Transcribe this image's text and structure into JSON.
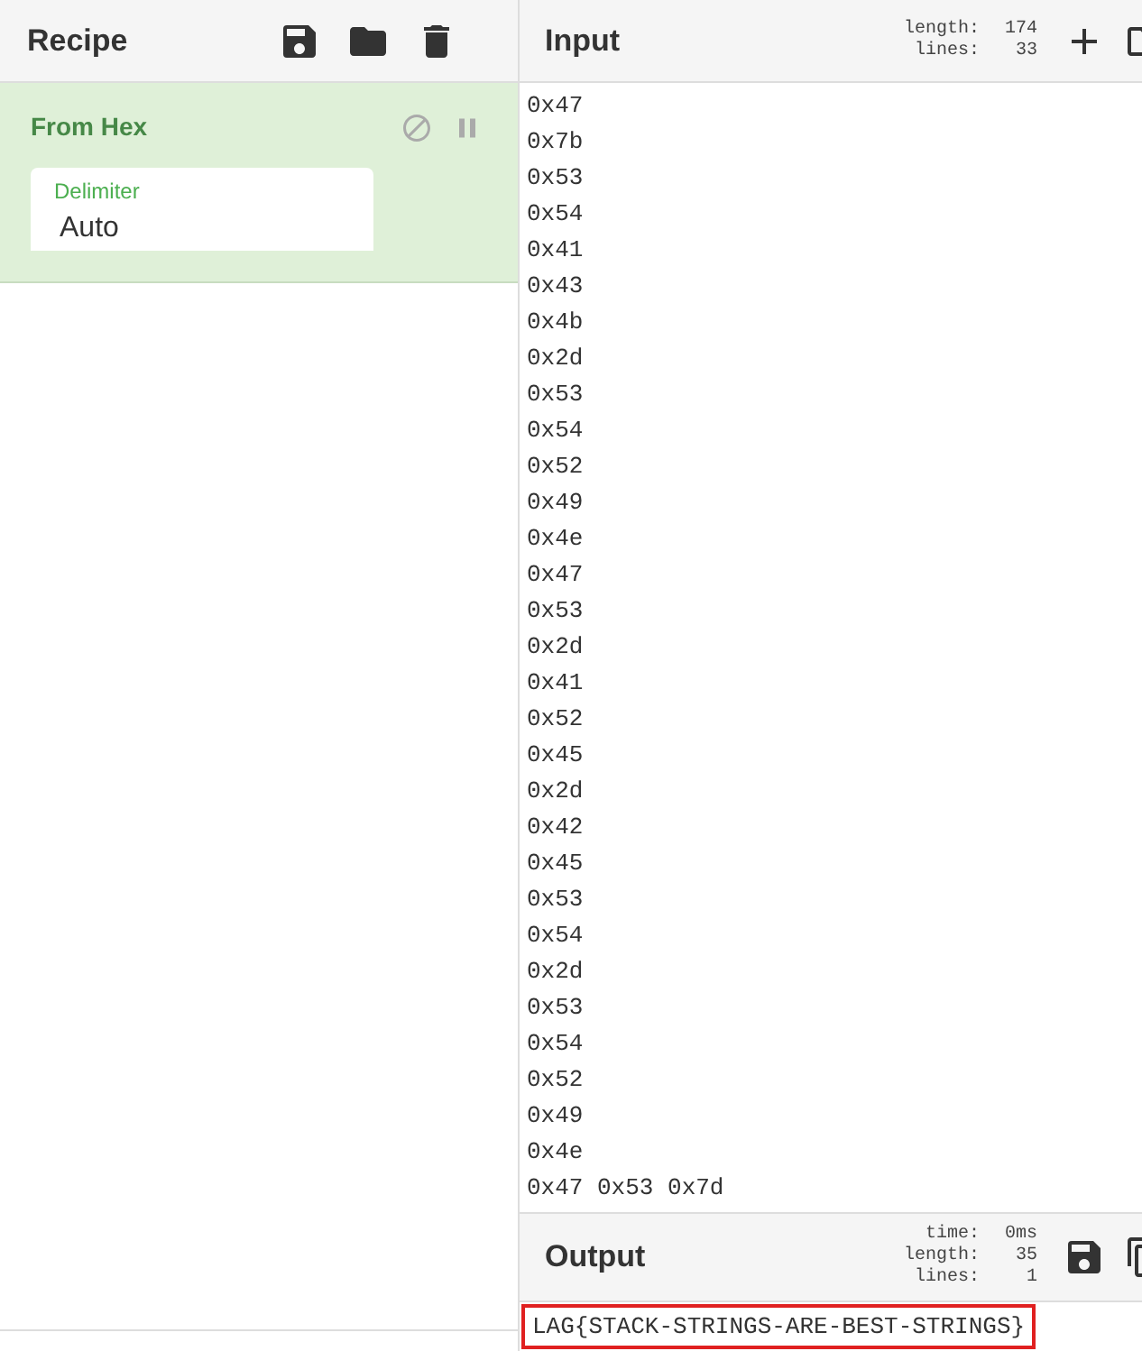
{
  "recipe": {
    "title": "Recipe",
    "operations": [
      {
        "name": "From Hex",
        "disabled": false,
        "breakpoint": false,
        "args": [
          {
            "label": "Delimiter",
            "value": "Auto"
          }
        ]
      }
    ]
  },
  "input": {
    "title": "Input",
    "stats": [
      {
        "label": "length:",
        "value": "174"
      },
      {
        "label": "lines:",
        "value": "33"
      }
    ],
    "lines": [
      "0x47",
      "0x7b",
      "0x53",
      "0x54",
      "0x41",
      "0x43",
      "0x4b",
      "0x2d",
      "0x53",
      "0x54",
      "0x52",
      "0x49",
      "0x4e",
      "0x47",
      "0x53",
      "0x2d",
      "0x41",
      "0x52",
      "0x45",
      "0x2d",
      "0x42",
      "0x45",
      "0x53",
      "0x54",
      "0x2d",
      "0x53",
      "0x54",
      "0x52",
      "0x49",
      "0x4e",
      "0x47 0x53 0x7d"
    ]
  },
  "output": {
    "title": "Output",
    "stats": [
      {
        "label": "time:",
        "value": "0ms"
      },
      {
        "label": "length:",
        "value": "35"
      },
      {
        "label": "lines:",
        "value": "1"
      }
    ],
    "text": "LAG{STACK-STRINGS-ARE-BEST-STRINGS}",
    "highlighted": true
  }
}
